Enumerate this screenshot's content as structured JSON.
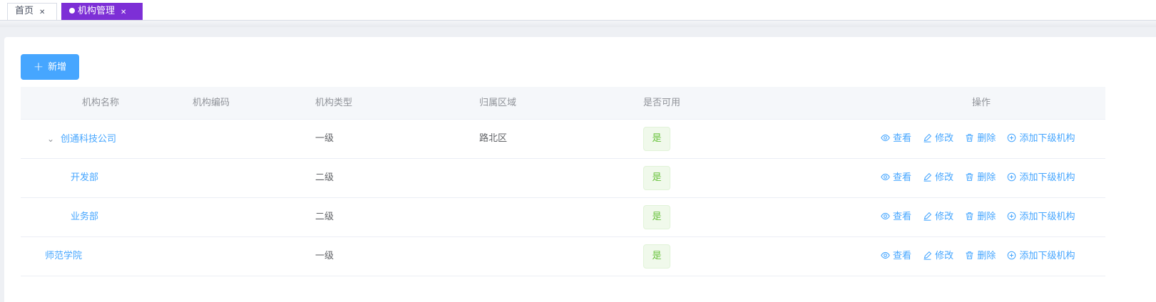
{
  "tabs": [
    {
      "label": "首页",
      "active": false
    },
    {
      "label": "机构管理",
      "active": true
    }
  ],
  "toolbar": {
    "add_label": "新增"
  },
  "table": {
    "headers": {
      "name": "机构名称",
      "code": "机构编码",
      "type": "机构类型",
      "region": "归属区域",
      "enabled": "是否可用",
      "actions": "操作"
    },
    "rows": [
      {
        "name": "创通科技公司",
        "code": "",
        "type": "一级",
        "region": "路北区",
        "enabled": "是",
        "level": 0,
        "expanded": true
      },
      {
        "name": "开发部",
        "code": "",
        "type": "二级",
        "region": "",
        "enabled": "是",
        "level": 1
      },
      {
        "name": "业务部",
        "code": "",
        "type": "二级",
        "region": "",
        "enabled": "是",
        "level": 1
      },
      {
        "name": "师范学院",
        "code": "",
        "type": "一级",
        "region": "",
        "enabled": "是",
        "level": 0
      }
    ],
    "actions": {
      "view": "查看",
      "edit": "修改",
      "delete": "删除",
      "add_child": "添加下级机构"
    }
  },
  "colors": {
    "primary": "#46a6ff",
    "active_tab": "#7d2fd6",
    "success": "#67c23a"
  }
}
